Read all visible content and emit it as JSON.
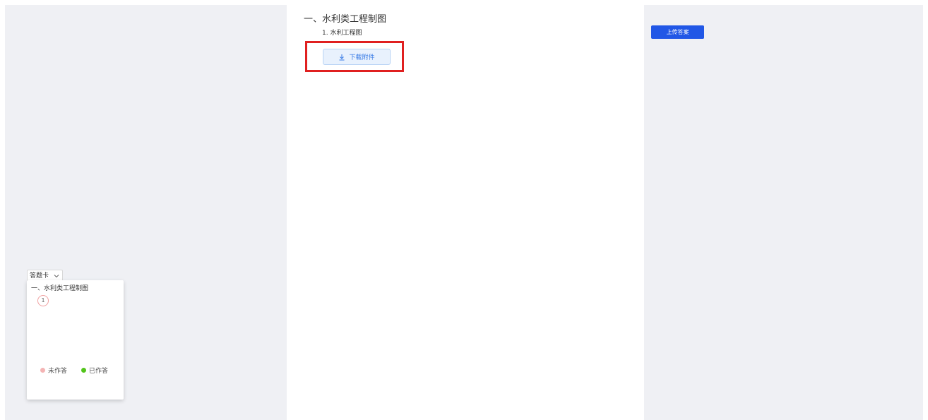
{
  "paper": {
    "section_title": "一、水利类工程制图",
    "question_title": "1. 水利工程图",
    "download_label": "下载附件",
    "download_icon": "download-icon"
  },
  "answer_card": {
    "toggle_label": "答题卡",
    "toggle_icon": "chevron-down-icon",
    "section_title": "一、水利类工程制图",
    "questions": [
      "1"
    ],
    "legend": {
      "unanswered_label": "未作答",
      "unanswered_color": "#f4b4b4",
      "answered_label": "已作答",
      "answered_color": "#52c41a"
    }
  },
  "actions": {
    "upload_label": "上传答案",
    "upload_color": "#2157e6"
  },
  "highlight_color": "#e02020"
}
